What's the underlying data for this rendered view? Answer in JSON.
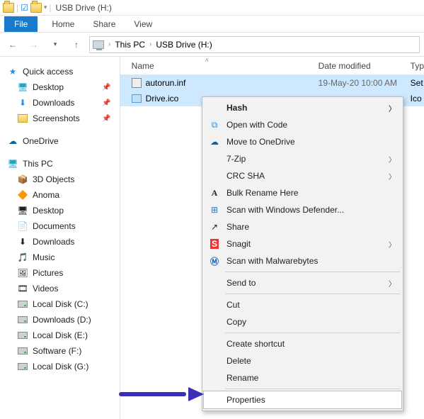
{
  "titlebar": {
    "title": "USB Drive (H:)"
  },
  "ribbon": {
    "file": "File",
    "tabs": [
      "Home",
      "Share",
      "View"
    ]
  },
  "breadcrumb": {
    "root": "This PC",
    "current": "USB Drive (H:)"
  },
  "columns": {
    "name": "Name",
    "date": "Date modified",
    "type": "Typ"
  },
  "files": [
    {
      "name": "autorun.inf",
      "date": "19-May-20 10:00 AM",
      "type": "Set"
    },
    {
      "name": "Drive.ico",
      "date": "",
      "type": "Ico"
    }
  ],
  "sidebar": {
    "quick": {
      "label": "Quick access",
      "items": [
        {
          "label": "Desktop",
          "pinned": true
        },
        {
          "label": "Downloads",
          "pinned": true
        },
        {
          "label": "Screenshots",
          "pinned": true
        }
      ]
    },
    "onedrive": {
      "label": "OneDrive"
    },
    "thispc": {
      "label": "This PC",
      "items": [
        "3D Objects",
        "Anoma",
        "Desktop",
        "Documents",
        "Downloads",
        "Music",
        "Pictures",
        "Videos",
        "Local Disk (C:)",
        "Downloads  (D:)",
        "Local Disk (E:)",
        "Software (F:)",
        "Local Disk (G:)"
      ]
    }
  },
  "context_menu": {
    "groups": [
      [
        {
          "label": "Hash",
          "bold": true,
          "submenu": true,
          "icon": ""
        },
        {
          "label": "Open with Code",
          "icon": "vscode"
        },
        {
          "label": "Move to OneDrive",
          "icon": "onedrive"
        },
        {
          "label": "7-Zip",
          "submenu": true,
          "icon": ""
        },
        {
          "label": "CRC SHA",
          "submenu": true,
          "icon": ""
        },
        {
          "label": "Bulk Rename Here",
          "icon": "A"
        },
        {
          "label": "Scan with Windows Defender...",
          "icon": "shield"
        },
        {
          "label": "Share",
          "icon": "share"
        },
        {
          "label": "Snagit",
          "submenu": true,
          "icon": "snagit"
        },
        {
          "label": "Scan with Malwarebytes",
          "icon": "mb"
        }
      ],
      [
        {
          "label": "Send to",
          "submenu": true,
          "icon": ""
        }
      ],
      [
        {
          "label": "Cut",
          "icon": ""
        },
        {
          "label": "Copy",
          "icon": ""
        }
      ],
      [
        {
          "label": "Create shortcut",
          "icon": ""
        },
        {
          "label": "Delete",
          "icon": ""
        },
        {
          "label": "Rename",
          "icon": ""
        }
      ],
      [
        {
          "label": "Properties",
          "icon": "",
          "highlight": true
        }
      ]
    ]
  }
}
